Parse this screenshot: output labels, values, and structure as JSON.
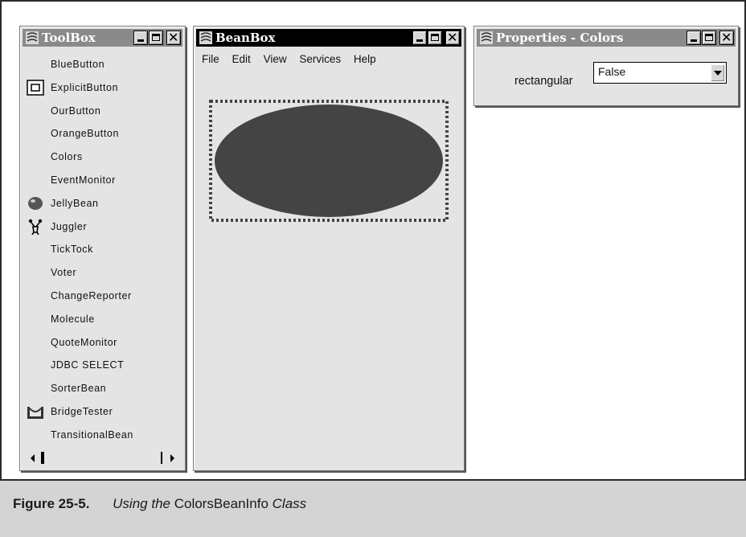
{
  "toolbox": {
    "title": "ToolBox",
    "items": [
      {
        "label": "BlueButton",
        "icon": ""
      },
      {
        "label": "ExplicitButton",
        "icon": "button-icon"
      },
      {
        "label": "OurButton",
        "icon": ""
      },
      {
        "label": "OrangeButton",
        "icon": ""
      },
      {
        "label": "Colors",
        "icon": ""
      },
      {
        "label": "EventMonitor",
        "icon": ""
      },
      {
        "label": "JellyBean",
        "icon": "jellybean-icon"
      },
      {
        "label": "Juggler",
        "icon": "juggler-icon"
      },
      {
        "label": "TickTock",
        "icon": ""
      },
      {
        "label": "Voter",
        "icon": ""
      },
      {
        "label": "ChangeReporter",
        "icon": ""
      },
      {
        "label": "Molecule",
        "icon": ""
      },
      {
        "label": "QuoteMonitor",
        "icon": ""
      },
      {
        "label": "JDBC SELECT",
        "icon": ""
      },
      {
        "label": "SorterBean",
        "icon": ""
      },
      {
        "label": "BridgeTester",
        "icon": "bridge-icon"
      },
      {
        "label": "TransitionalBean",
        "icon": ""
      }
    ]
  },
  "beanbox": {
    "title": "BeanBox",
    "menu": [
      "File",
      "Edit",
      "View",
      "Services",
      "Help"
    ],
    "bean_color": "#444444"
  },
  "properties": {
    "title": "Properties - Colors",
    "property_label": "rectangular",
    "property_value": "False"
  },
  "caption": {
    "figure_number": "Figure 25-5.",
    "text_prefix": "Using the",
    "text_class": "ColorsBeanInfo",
    "text_suffix": "Class"
  }
}
